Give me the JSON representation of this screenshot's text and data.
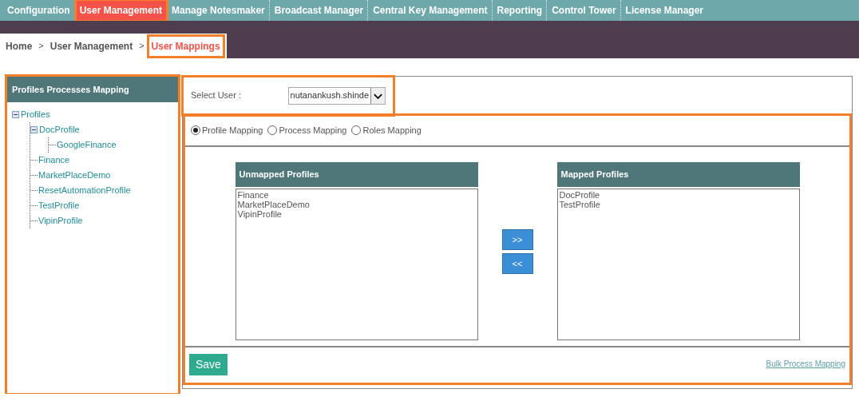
{
  "top_nav": [
    {
      "label": "Configuration",
      "selected": false,
      "highlighted": false
    },
    {
      "label": "User Management",
      "selected": true,
      "highlighted": true
    },
    {
      "label": "Manage Notesmaker",
      "selected": false,
      "highlighted": false
    },
    {
      "label": "Broadcast Manager",
      "selected": false,
      "highlighted": false
    },
    {
      "label": "Central Key Management",
      "selected": false,
      "highlighted": false
    },
    {
      "label": "Reporting",
      "selected": false,
      "highlighted": false
    },
    {
      "label": "Control Tower",
      "selected": false,
      "highlighted": false
    },
    {
      "label": "License Manager",
      "selected": false,
      "highlighted": false
    }
  ],
  "breadcrumb": [
    {
      "label": "Home",
      "current": false,
      "highlighted": false
    },
    {
      "label": ">",
      "kind": "separator"
    },
    {
      "label": "User Management",
      "current": false,
      "highlighted": false
    },
    {
      "label": ">",
      "kind": "separator"
    },
    {
      "label": "User Mappings",
      "current": true,
      "highlighted": true
    }
  ],
  "sidebar": {
    "title": "Profiles Processes Mapping",
    "highlighted": true,
    "tree": [
      {
        "label": "Profiles",
        "expanded": true,
        "children": [
          {
            "label": "DocProfile",
            "expanded": true,
            "children": [
              {
                "label": "GoogleFinance"
              }
            ]
          },
          {
            "label": "Finance"
          },
          {
            "label": "MarketPlaceDemo"
          },
          {
            "label": "ResetAutomationProfile"
          },
          {
            "label": "TestProfile"
          },
          {
            "label": "VipinProfile"
          }
        ]
      }
    ]
  },
  "select_user": {
    "label": "Select User  :",
    "value": "nutanankush.shinde",
    "highlighted": true
  },
  "mapping": {
    "highlighted": true,
    "modes": [
      {
        "label": "Profile Mapping",
        "selected": true
      },
      {
        "label": "Process Mapping",
        "selected": false
      },
      {
        "label": "Roles Mapping",
        "selected": false
      }
    ],
    "unmapped": {
      "title": "Unmapped Profiles",
      "items": [
        "Finance",
        "MarketPlaceDemo",
        "VipinProfile"
      ]
    },
    "move_buttons": [
      ">>",
      "<<"
    ],
    "mapped": {
      "title": "Mapped Profiles",
      "items": [
        "DocProfile",
        "TestProfile"
      ]
    },
    "save_button": "Save",
    "bulk_link": "Bulk Process Mapping"
  }
}
